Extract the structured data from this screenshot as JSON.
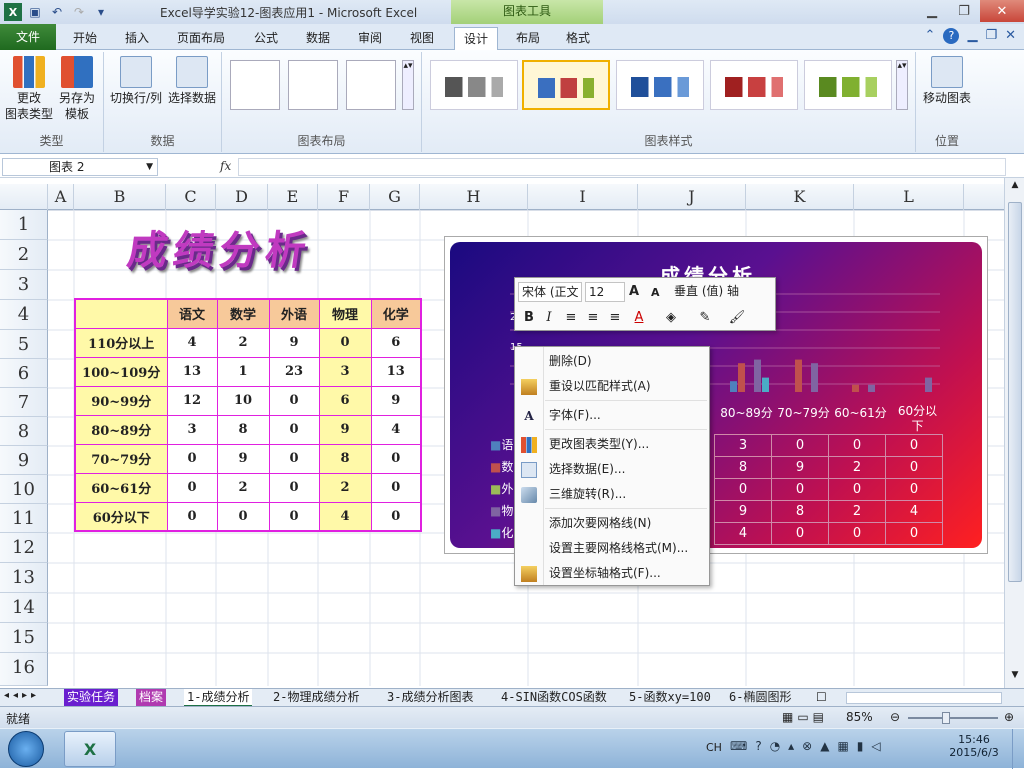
{
  "window": {
    "title": "Excel导学实验12-图表应用1 - Microsoft Excel",
    "context_tab_group": "图表工具"
  },
  "tabs": [
    "文件",
    "开始",
    "插入",
    "页面布局",
    "公式",
    "数据",
    "审阅",
    "视图",
    "设计",
    "布局",
    "格式"
  ],
  "ribbon": {
    "type_group": {
      "label": "类型",
      "change_type": "更改\n图表类型",
      "save_template": "另存为\n模板"
    },
    "data_group": {
      "label": "数据",
      "switch": "切换行/列",
      "select": "选择数据"
    },
    "layout_group": {
      "label": "图表布局"
    },
    "style_group": {
      "label": "图表样式"
    },
    "location_group": {
      "label": "位置",
      "move": "移动图表"
    }
  },
  "formula_bar": {
    "name_box": "图表 2",
    "fx": "fx"
  },
  "columns": [
    "A",
    "B",
    "C",
    "D",
    "E",
    "F",
    "G",
    "H",
    "I",
    "J",
    "K",
    "L"
  ],
  "rows": [
    "1",
    "2",
    "3",
    "4",
    "5",
    "6",
    "7",
    "8",
    "9",
    "10",
    "11",
    "12",
    "13",
    "14",
    "15",
    "16"
  ],
  "sheet": {
    "title": "成绩分析",
    "headers": [
      "语文",
      "数学",
      "外语",
      "物理",
      "化学"
    ],
    "table": [
      [
        "110分以上",
        "4",
        "2",
        "9",
        "0",
        "6"
      ],
      [
        "100~109分",
        "13",
        "1",
        "23",
        "3",
        "13"
      ],
      [
        "90~99分",
        "12",
        "10",
        "0",
        "6",
        "9"
      ],
      [
        "80~89分",
        "3",
        "8",
        "0",
        "9",
        "4"
      ],
      [
        "70~79分",
        "0",
        "9",
        "0",
        "8",
        "0"
      ],
      [
        "60~61分",
        "0",
        "2",
        "0",
        "2",
        "0"
      ],
      [
        "60分以下",
        "0",
        "0",
        "0",
        "4",
        "0"
      ]
    ]
  },
  "chart": {
    "title": "成绩分析",
    "visible_categories": [
      "80~89分",
      "70~79分",
      "60~61分",
      "60分以\n下"
    ],
    "visible_legend": [
      "语",
      "数",
      "外",
      "物",
      "化"
    ],
    "visible_rows": [
      [
        "3",
        "0",
        "0",
        "0"
      ],
      [
        "8",
        "9",
        "2",
        "0"
      ],
      [
        "0",
        "0",
        "0",
        "0"
      ],
      [
        "9",
        "8",
        "2",
        "4"
      ],
      [
        "4",
        "0",
        "0",
        "0"
      ]
    ],
    "axis_visible": [
      "20",
      "15"
    ]
  },
  "mini_toolbar": {
    "font": "宋体 (正文",
    "size": "12",
    "axis": "垂直 (值) 轴"
  },
  "context_menu": [
    {
      "label": "删除(D)",
      "icon": ""
    },
    {
      "label": "重设以匹配样式(A)",
      "icon": "reset-style-icon"
    },
    {
      "label": "字体(F)...",
      "icon": "font-icon"
    },
    {
      "label": "更改图表类型(Y)...",
      "icon": "chart-type-icon"
    },
    {
      "label": "选择数据(E)...",
      "icon": "select-data-icon"
    },
    {
      "label": "三维旋转(R)...",
      "icon": "3d-rotate-icon"
    },
    {
      "label": "添加次要网格线(N)",
      "icon": ""
    },
    {
      "label": "设置主要网格线格式(M)...",
      "icon": ""
    },
    {
      "label": "设置坐标轴格式(F)...",
      "icon": "format-axis-icon"
    }
  ],
  "sheet_tabs": [
    "实验任务",
    "档案",
    "1-成绩分析",
    "2-物理成绩分析",
    "3-成绩分析图表",
    "4-SIN函数COS函数",
    "5-函数xy=100",
    "6-椭圆图形"
  ],
  "status": {
    "ready": "就绪",
    "zoom": "85%"
  },
  "taskbar": {
    "lang": "CH",
    "time": "15:46",
    "date": "2015/6/3"
  }
}
